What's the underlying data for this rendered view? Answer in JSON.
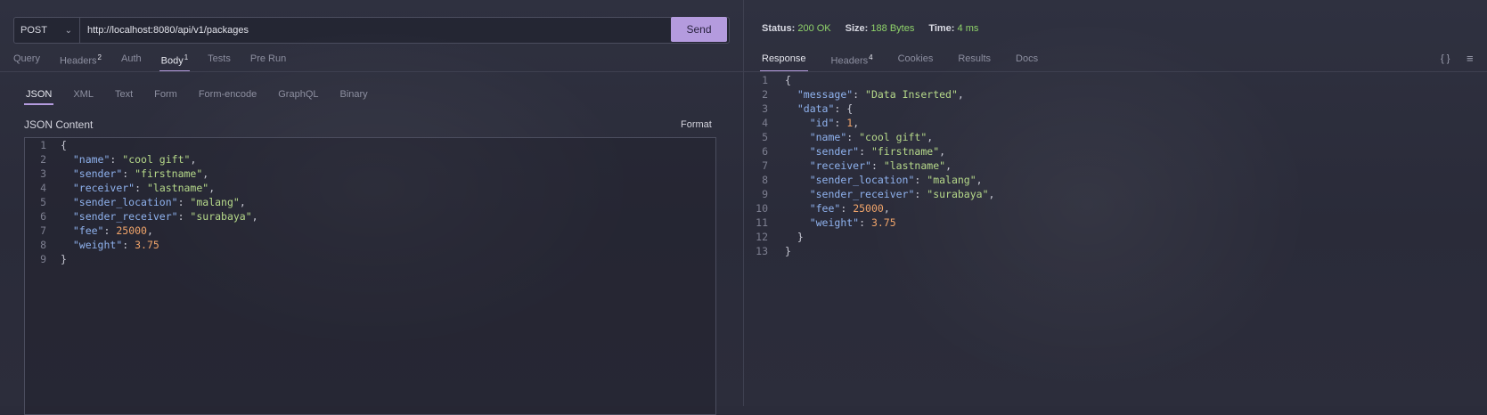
{
  "request": {
    "method": "POST",
    "url": "http://localhost:8080/api/v1/packages",
    "send_label": "Send",
    "tabs": [
      {
        "label": "Query",
        "badge": ""
      },
      {
        "label": "Headers",
        "badge": "2"
      },
      {
        "label": "Auth",
        "badge": ""
      },
      {
        "label": "Body",
        "badge": "1"
      },
      {
        "label": "Tests",
        "badge": ""
      },
      {
        "label": "Pre Run",
        "badge": ""
      }
    ],
    "body_tabs": [
      "JSON",
      "XML",
      "Text",
      "Form",
      "Form-encode",
      "GraphQL",
      "Binary"
    ],
    "content_label": "JSON Content",
    "format_label": "Format",
    "lines": [
      {
        "n": "1",
        "p1": "{"
      },
      {
        "n": "2",
        "ind": "  ",
        "k": "\"name\"",
        "p1": ": ",
        "s": "\"cool gift\"",
        "p2": ","
      },
      {
        "n": "3",
        "ind": "  ",
        "k": "\"sender\"",
        "p1": ": ",
        "s": "\"firstname\"",
        "p2": ","
      },
      {
        "n": "4",
        "ind": "  ",
        "k": "\"receiver\"",
        "p1": ": ",
        "s": "\"lastname\"",
        "p2": ","
      },
      {
        "n": "5",
        "ind": "  ",
        "k": "\"sender_location\"",
        "p1": ": ",
        "s": "\"malang\"",
        "p2": ","
      },
      {
        "n": "6",
        "ind": "  ",
        "k": "\"sender_receiver\"",
        "p1": ": ",
        "s": "\"surabaya\"",
        "p2": ","
      },
      {
        "n": "7",
        "ind": "  ",
        "k": "\"fee\"",
        "p1": ": ",
        "num": "25000",
        "p2": ","
      },
      {
        "n": "8",
        "ind": "  ",
        "k": "\"weight\"",
        "p1": ": ",
        "num": "3.75"
      },
      {
        "n": "9",
        "p1": "}"
      }
    ]
  },
  "response": {
    "status_label": "Status:",
    "status_value": "200 OK",
    "size_label": "Size:",
    "size_value": "188 Bytes",
    "time_label": "Time:",
    "time_value": "4 ms",
    "tabs": [
      {
        "label": "Response",
        "badge": ""
      },
      {
        "label": "Headers",
        "badge": "4"
      },
      {
        "label": "Cookies",
        "badge": ""
      },
      {
        "label": "Results",
        "badge": ""
      },
      {
        "label": "Docs",
        "badge": ""
      }
    ],
    "lines": [
      {
        "n": "1",
        "p1": "{"
      },
      {
        "n": "2",
        "ind": "  ",
        "k": "\"message\"",
        "p1": ": ",
        "s": "\"Data Inserted\"",
        "p2": ","
      },
      {
        "n": "3",
        "ind": "  ",
        "k": "\"data\"",
        "p1": ": {"
      },
      {
        "n": "4",
        "ind": "    ",
        "k": "\"id\"",
        "p1": ": ",
        "num": "1",
        "p2": ","
      },
      {
        "n": "5",
        "ind": "    ",
        "k": "\"name\"",
        "p1": ": ",
        "s": "\"cool gift\"",
        "p2": ","
      },
      {
        "n": "6",
        "ind": "    ",
        "k": "\"sender\"",
        "p1": ": ",
        "s": "\"firstname\"",
        "p2": ","
      },
      {
        "n": "7",
        "ind": "    ",
        "k": "\"receiver\"",
        "p1": ": ",
        "s": "\"lastname\"",
        "p2": ","
      },
      {
        "n": "8",
        "ind": "    ",
        "k": "\"sender_location\"",
        "p1": ": ",
        "s": "\"malang\"",
        "p2": ","
      },
      {
        "n": "9",
        "ind": "    ",
        "k": "\"sender_receiver\"",
        "p1": ": ",
        "s": "\"surabaya\"",
        "p2": ","
      },
      {
        "n": "10",
        "ind": "    ",
        "k": "\"fee\"",
        "p1": ": ",
        "num": "25000",
        "p2": ","
      },
      {
        "n": "11",
        "ind": "    ",
        "k": "\"weight\"",
        "p1": ": ",
        "num": "3.75"
      },
      {
        "n": "12",
        "ind": "  ",
        "p1": "}"
      },
      {
        "n": "13",
        "p1": "}"
      }
    ]
  },
  "icons": {
    "braces": "{ }",
    "wrap": "≡"
  },
  "colors": {
    "accent": "#b49bde",
    "success": "#8fd36a",
    "key": "#8fb2ee",
    "string": "#b6d98a",
    "number": "#f0a46a"
  }
}
